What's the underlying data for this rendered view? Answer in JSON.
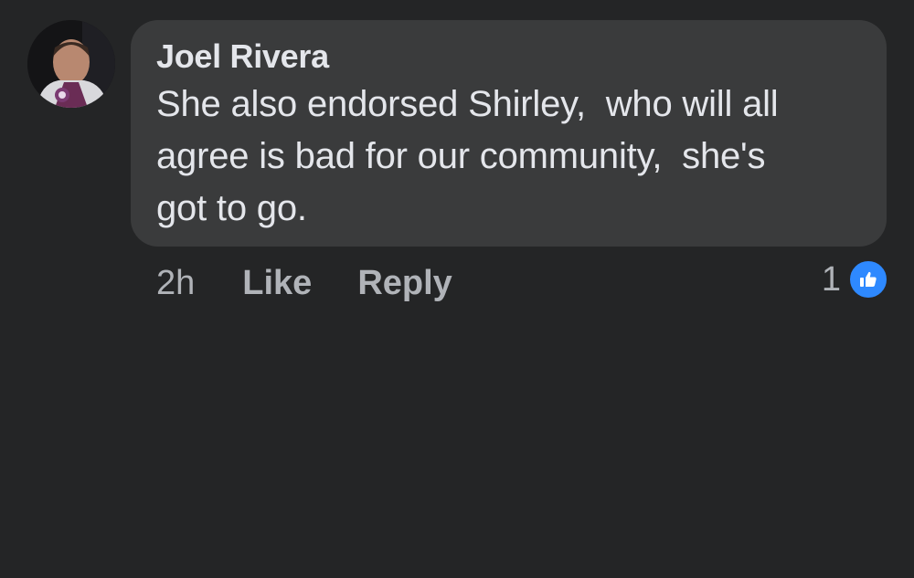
{
  "comment": {
    "author": "Joel Rivera",
    "text": "She also endorsed Shirley,  who will all\nagree is bad for our community,  she's\ngot to go.",
    "timestamp": "2h",
    "like_label": "Like",
    "reply_label": "Reply",
    "reaction_count": "1",
    "reaction_icon": "thumbs-up-icon",
    "avatar_icon": "profile-photo"
  },
  "colors": {
    "background": "#242526",
    "bubble": "#3a3b3c",
    "text": "#e4e6eb",
    "secondary_text": "#b0b3b8",
    "like_blue": "#2e89ff"
  }
}
